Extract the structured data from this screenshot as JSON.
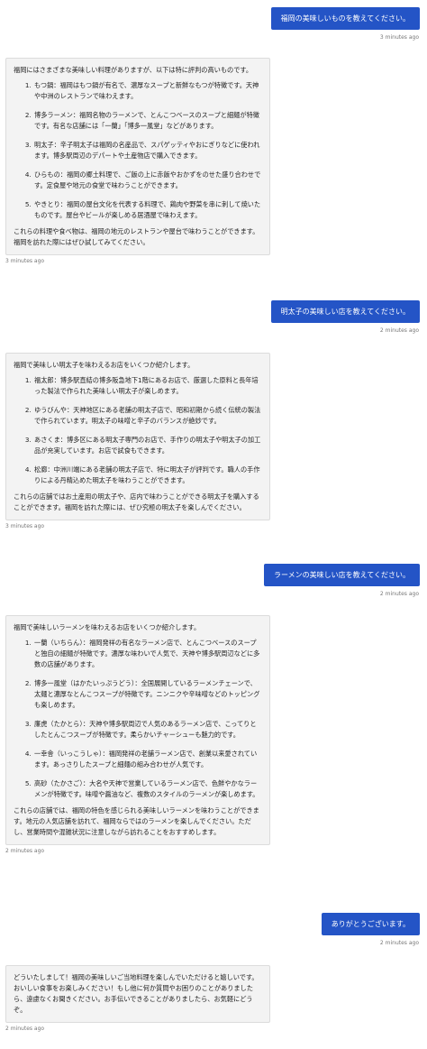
{
  "messages": [
    {
      "role": "user",
      "text": "福岡の美味しいものを教えてください。",
      "time": "3 minutes ago"
    },
    {
      "role": "assistant",
      "intro": "福岡にはさまざまな美味しい料理がありますが、以下は特に評判の高いものです。",
      "items": [
        "もつ鍋：福岡はもつ鍋が有名で、濃厚なスープと新鮮なもつが特徴です。天神や中洲のレストランで味わえます。",
        "博多ラーメン：福岡名物のラーメンで、とんこつベースのスープと細麺が特徴です。有名な店舗には「一蘭」「博多一風堂」などがあります。",
        "明太子：辛子明太子は福岡の名産品で、スパゲッティやおにぎりなどに使われます。博多駅周辺のデパートや土産物店で購入できます。",
        "ひらもの：福岡の郷土料理で、ご飯の上に赤飯やおかずをのせた盛り合わせです。定食屋や地元の食堂で味わうことができます。",
        "やきとり：福岡の屋台文化を代表する料理で、鶏肉や野菜を串に刺して焼いたものです。屋台やビールが楽しめる居酒屋で味わえます。"
      ],
      "outro": "これらの料理や食べ物は、福岡の地元のレストランや屋台で味わうことができます。福岡を訪れた際にはぜひ試してみてください。",
      "time": "3 minutes ago"
    },
    {
      "role": "user",
      "text": "明太子の美味しい店を教えてください。",
      "time": "2 minutes ago"
    },
    {
      "role": "assistant",
      "intro": "福岡で美味しい明太子を味わえるお店をいくつか紹介します。",
      "items": [
        "福太郎：博多駅直結の博多阪急地下1階にあるお店で、厳選した原料と長年培った製法で作られた美味しい明太子が楽しめます。",
        "ゆうびんや：天神地区にある老舗の明太子店で、昭和初期から続く伝統の製法で作られています。明太子の味噌と辛子のバランスが絶妙です。",
        "あさくま：博多区にある明太子専門のお店で、手作りの明太子や明太子の加工品が充実しています。お店で試食もできます。",
        "松廊：中洲川端にある老舗の明太子店で、特に明太子が評判です。職人の手作りによる丹精込めた明太子を味わうことができます。"
      ],
      "outro": "これらの店舗ではお土産用の明太子や、店内で味わうことができる明太子を購入することができます。福岡を訪れた際には、ぜひ究極の明太子を楽しんでください。",
      "time": "3 minutes ago"
    },
    {
      "role": "user",
      "text": "ラーメンの美味しい店を教えてください。",
      "time": "2 minutes ago"
    },
    {
      "role": "assistant",
      "intro": "福岡で美味しいラーメンを味わえるお店をいくつか紹介します。",
      "items": [
        "一蘭（いちらん）：福岡発祥の有名なラーメン店で、とんこつベースのスープと独自の細麺が特徴です。濃厚な味わいで人気で、天神や博多駅周辺などに多数の店舗があります。",
        "博多一風堂（はかたいっぷうどう）：全国展開しているラーメンチェーンで、太麺と濃厚なとんこつスープが特徴です。ニンニクや辛味噌などのトッピングも楽しめます。",
        "廉虎（たかとら）：天神や博多駅周辺で人気のあるラーメン店で、こってりとしたとんこつスープが特徴です。柔らかいチャーシューも魅力的です。",
        "一幸舎（いっこうしゃ）：福岡発祥の老舗ラーメン店で、創業以来愛されています。あっさりしたスープと細麺の組み合わせが人気です。",
        "高砂（たかさご）：大名や天神で営業しているラーメン店で、色鮮やかなラーメンが特徴です。味噌や醤油など、複数のスタイルのラーメンが楽しめます。"
      ],
      "outro": "これらの店舗では、福岡の特色を感じられる美味しいラーメンを味わうことができます。地元の人気店舗を訪れて、福岡ならではのラーメンを楽しんでください。ただし、営業時間や混雑状況に注意しながら訪れることをおすすめします。",
      "time": "2 minutes ago"
    },
    {
      "role": "user",
      "text": "ありがとうございます。",
      "time": "2 minutes ago"
    },
    {
      "role": "assistant",
      "intro": "どういたしまして！福岡の美味しいご当地料理を楽しんでいただけると嬉しいです。おいしい食事をお楽しみください！もし他に何か質問やお困りのことがありましたら、遠慮なくお聞きください。お手伝いできることがありましたら、お気軽にどうぞ。",
      "items": [],
      "outro": "",
      "time": "2 minutes ago"
    }
  ]
}
